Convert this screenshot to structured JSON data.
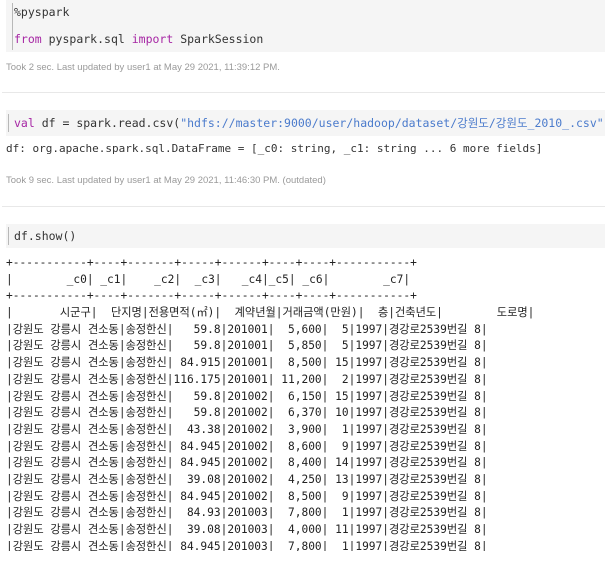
{
  "cells": [
    {
      "code_lines": [
        {
          "tokens": [
            {
              "text": "%pyspark",
              "style": "plain"
            }
          ]
        },
        {
          "tokens": [
            {
              "text": "from",
              "style": "kw"
            },
            {
              "text": " pyspark.sql ",
              "style": "plain"
            },
            {
              "text": "import",
              "style": "kw"
            },
            {
              "text": " SparkSession",
              "style": "plain"
            }
          ]
        }
      ],
      "status": "Took 2 sec. Last updated by user1 at May 29 2021, 11:39:12 PM."
    },
    {
      "code_lines": [
        {
          "tokens": [
            {
              "text": "val",
              "style": "kw"
            },
            {
              "text": " df = spark.read.csv(",
              "style": "plain"
            },
            {
              "text": "\"hdfs://master:9000/user/hadoop/dataset/강원도/강원도_2010_.csv\"",
              "style": "str"
            },
            {
              "text": ")",
              "style": "plain"
            }
          ]
        }
      ],
      "result": "df: org.apache.spark.sql.DataFrame = [_c0: string, _c1: string ... 6 more fields]",
      "status": "Took 9 sec. Last updated by user1 at May 29 2021, 11:46:30 PM. (outdated)"
    },
    {
      "code_lines": [
        {
          "tokens": [
            {
              "text": "df.show()",
              "style": "plain"
            }
          ]
        }
      ],
      "table_lines": [
        "+-----------+----+-------+-----+------+----+----+-----------+",
        "|        _c0| _c1|    _c2|  _c3|   _c4|_c5| _c6|        _c7|",
        "+-----------+----+-------+-----+------+----+----+-----------+",
        "|       시군구|  단지명|전용면적(㎡)|  계약년월|거래금액(만원)|  층|건축년도|        도로명|",
        "|강원도 강릉시 견소동|송정한신|   59.8|201001|  5,600|  5|1997|경강로2539번길 8|",
        "|강원도 강릉시 견소동|송정한신|   59.8|201001|  5,850|  5|1997|경강로2539번길 8|",
        "|강원도 강릉시 견소동|송정한신| 84.915|201001|  8,500| 15|1997|경강로2539번길 8|",
        "|강원도 강릉시 견소동|송정한신|116.175|201001| 11,200|  2|1997|경강로2539번길 8|",
        "|강원도 강릉시 견소동|송정한신|   59.8|201002|  6,150| 15|1997|경강로2539번길 8|",
        "|강원도 강릉시 견소동|송정한신|   59.8|201002|  6,370| 10|1997|경강로2539번길 8|",
        "|강원도 강릉시 견소동|송정한신|  43.38|201002|  3,900|  1|1997|경강로2539번길 8|",
        "|강원도 강릉시 견소동|송정한신| 84.945|201002|  8,600|  9|1997|경강로2539번길 8|",
        "|강원도 강릉시 견소동|송정한신| 84.945|201002|  8,400| 14|1997|경강로2539번길 8|",
        "|강원도 강릉시 견소동|송정한신|  39.08|201002|  4,250| 13|1997|경강로2539번길 8|",
        "|강원도 강릉시 견소동|송정한신| 84.945|201002|  8,500|  9|1997|경강로2539번길 8|",
        "|강원도 강릉시 견소동|송정한신|  84.93|201003|  7,800|  1|1997|경강로2539번길 8|",
        "|강원도 강릉시 견소동|송정한신|  39.08|201003|  4,000| 11|1997|경강로2539번길 8|",
        "|강원도 강릉시 견소동|송정한신| 84.945|201003|  7,800|  1|1997|경강로2539번길 8|"
      ]
    }
  ]
}
